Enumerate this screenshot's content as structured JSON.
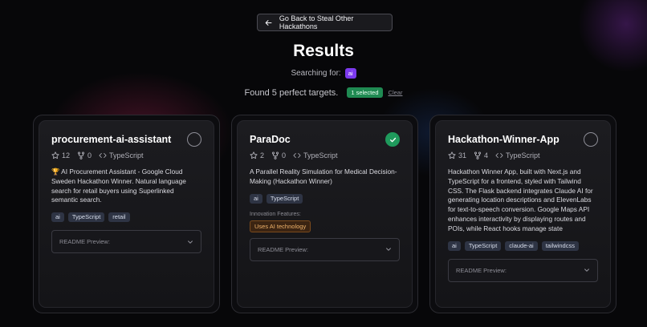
{
  "header": {
    "back_label": "Go Back to Steal Other Hackathons",
    "title": "Results",
    "searching_label": "Searching for:",
    "search_tag": "ai",
    "found_text": "Found 5 perfect targets.",
    "selected_badge": "1 selected",
    "clear_label": "Clear"
  },
  "colors": {
    "accent_purple": "#7c3aed",
    "selected_green": "#1f9a5c",
    "innovation_orange": "#f0b36a"
  },
  "icons": {
    "back": "arrow-left-icon",
    "star": "star-icon",
    "fork": "fork-icon",
    "code": "code-icon",
    "check": "check-icon",
    "chevron": "chevron-down-icon"
  },
  "cards": [
    {
      "title": "procurement-ai-assistant",
      "stars": "12",
      "forks": "0",
      "language": "TypeScript",
      "description": "🏆 AI Procurement Assistant - Google Cloud Sweden Hackathon Winner. Natural language search for retail buyers using Superlinked semantic search.",
      "tags": [
        "ai",
        "TypeScript",
        "retail"
      ],
      "selected": false,
      "readme_label": "README Preview:"
    },
    {
      "title": "ParaDoc",
      "stars": "2",
      "forks": "0",
      "language": "TypeScript",
      "description": "A Parallel Reality Simulation for Medical Decision-Making (Hackathon Winner)",
      "tags": [
        "ai",
        "TypeScript"
      ],
      "innovation_label": "Innovation Features:",
      "innovation_tag": "Uses AI technology",
      "selected": true,
      "readme_label": "README Preview:"
    },
    {
      "title": "Hackathon-Winner-App",
      "stars": "31",
      "forks": "4",
      "language": "TypeScript",
      "description": "Hackathon Winner App, built with Next.js and TypeScript for a frontend, styled with Tailwind CSS. The Flask backend integrates Claude AI for generating location descriptions and ElevenLabs for text-to-speech conversion. Google Maps API enhances interactivity by displaying routes and POIs, while React hooks manage state",
      "tags": [
        "ai",
        "TypeScript",
        "claude-ai",
        "tailwindcss"
      ],
      "selected": false,
      "readme_label": "README Preview:"
    }
  ]
}
